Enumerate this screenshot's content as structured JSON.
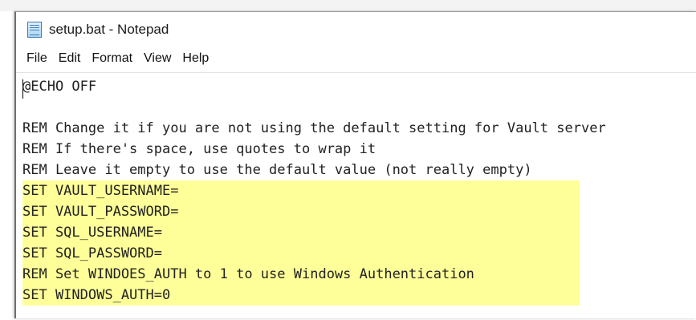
{
  "window": {
    "title": "setup.bat - Notepad"
  },
  "menu": [
    "File",
    "Edit",
    "Format",
    "View",
    "Help"
  ],
  "editor": {
    "lines": [
      "@ECHO OFF",
      "",
      "REM Change it if you are not using the default setting for Vault server",
      "REM If there's space, use quotes to wrap it",
      "REM Leave it empty to use the default value (not really empty)",
      "SET VAULT_USERNAME=",
      "SET VAULT_PASSWORD=",
      "SET SQL_USERNAME=",
      "SET SQL_PASSWORD=",
      "REM Set WINDOES_AUTH to 1 to use Windows Authentication",
      "SET WINDOWS_AUTH=0"
    ],
    "highlight_color": "#ffff99"
  },
  "icons": {
    "app": "notepad-icon"
  }
}
